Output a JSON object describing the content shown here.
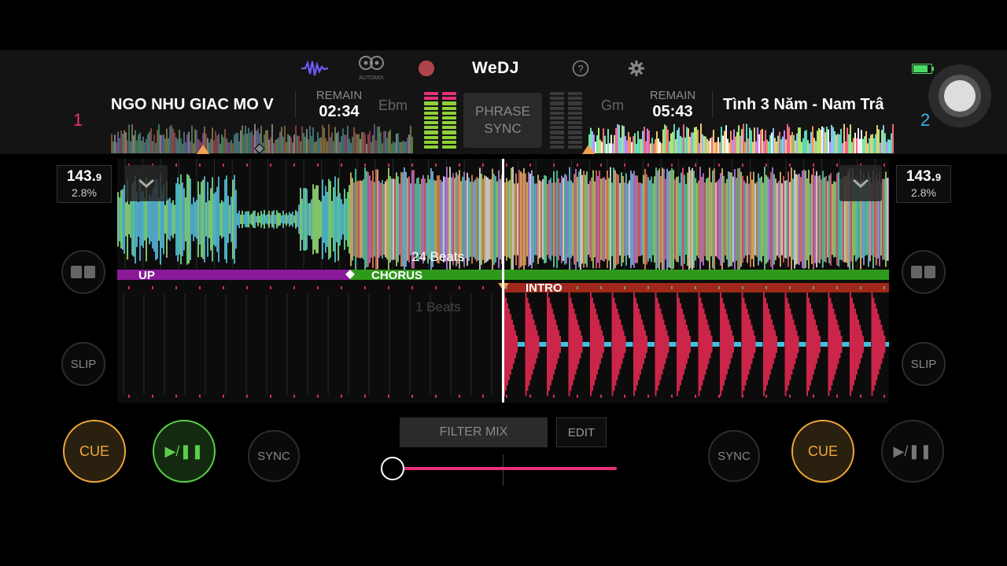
{
  "app": {
    "title": "WeDJ"
  },
  "toolbar": {
    "automix_label": "AUTOMIX",
    "colors": {
      "waveform_icon": "#6b5cff",
      "record": "#b0444c",
      "battery": "#4cd964"
    }
  },
  "deck1": {
    "number": "1",
    "title": "NGO NHU GIAC MO V",
    "remain_label": "REMAIN",
    "remain": "02:34",
    "key": "Ebm",
    "bpm_main": "143.",
    "bpm_decimal": "9",
    "pitch": "2.8%",
    "color": "#e6317a"
  },
  "deck2": {
    "number": "2",
    "title": "Tình 3 Năm - Nam Trâ",
    "remain_label": "REMAIN",
    "remain": "05:43",
    "key": "Gm",
    "bpm_main": "143.",
    "bpm_decimal": "9",
    "pitch": "2.8%",
    "color": "#3fb3e8"
  },
  "center": {
    "phrase_sync_line1": "PHRASE",
    "phrase_sync_line2": "SYNC"
  },
  "waveform": {
    "upper_beats": "24 Beats",
    "lower_beats": "1 Beats",
    "phrases_upper": [
      {
        "label": "UP",
        "color": "#8a1a9a"
      },
      {
        "label": "CHORUS",
        "color": "#2e9a1a"
      }
    ],
    "phrases_lower": [
      {
        "label": "INTRO",
        "color": "#a0281a"
      }
    ]
  },
  "controls": {
    "cue": "CUE",
    "play": "▶/❚❚",
    "sync": "SYNC",
    "slip": "SLIP",
    "filter_mix": "FILTER MIX",
    "edit": "EDIT",
    "crossfader_value": 0.0
  }
}
